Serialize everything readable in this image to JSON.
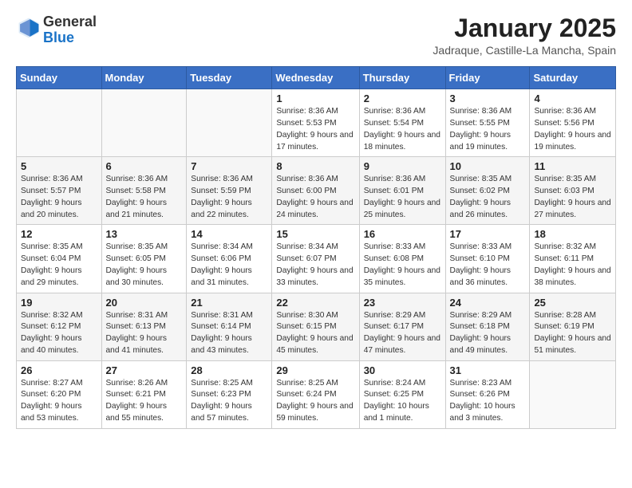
{
  "header": {
    "logo_general": "General",
    "logo_blue": "Blue",
    "month_year": "January 2025",
    "location": "Jadraque, Castille-La Mancha, Spain"
  },
  "weekdays": [
    "Sunday",
    "Monday",
    "Tuesday",
    "Wednesday",
    "Thursday",
    "Friday",
    "Saturday"
  ],
  "weeks": [
    [
      {
        "day": "",
        "info": ""
      },
      {
        "day": "",
        "info": ""
      },
      {
        "day": "",
        "info": ""
      },
      {
        "day": "1",
        "info": "Sunrise: 8:36 AM\nSunset: 5:53 PM\nDaylight: 9 hours\nand 17 minutes."
      },
      {
        "day": "2",
        "info": "Sunrise: 8:36 AM\nSunset: 5:54 PM\nDaylight: 9 hours\nand 18 minutes."
      },
      {
        "day": "3",
        "info": "Sunrise: 8:36 AM\nSunset: 5:55 PM\nDaylight: 9 hours\nand 19 minutes."
      },
      {
        "day": "4",
        "info": "Sunrise: 8:36 AM\nSunset: 5:56 PM\nDaylight: 9 hours\nand 19 minutes."
      }
    ],
    [
      {
        "day": "5",
        "info": "Sunrise: 8:36 AM\nSunset: 5:57 PM\nDaylight: 9 hours\nand 20 minutes."
      },
      {
        "day": "6",
        "info": "Sunrise: 8:36 AM\nSunset: 5:58 PM\nDaylight: 9 hours\nand 21 minutes."
      },
      {
        "day": "7",
        "info": "Sunrise: 8:36 AM\nSunset: 5:59 PM\nDaylight: 9 hours\nand 22 minutes."
      },
      {
        "day": "8",
        "info": "Sunrise: 8:36 AM\nSunset: 6:00 PM\nDaylight: 9 hours\nand 24 minutes."
      },
      {
        "day": "9",
        "info": "Sunrise: 8:36 AM\nSunset: 6:01 PM\nDaylight: 9 hours\nand 25 minutes."
      },
      {
        "day": "10",
        "info": "Sunrise: 8:35 AM\nSunset: 6:02 PM\nDaylight: 9 hours\nand 26 minutes."
      },
      {
        "day": "11",
        "info": "Sunrise: 8:35 AM\nSunset: 6:03 PM\nDaylight: 9 hours\nand 27 minutes."
      }
    ],
    [
      {
        "day": "12",
        "info": "Sunrise: 8:35 AM\nSunset: 6:04 PM\nDaylight: 9 hours\nand 29 minutes."
      },
      {
        "day": "13",
        "info": "Sunrise: 8:35 AM\nSunset: 6:05 PM\nDaylight: 9 hours\nand 30 minutes."
      },
      {
        "day": "14",
        "info": "Sunrise: 8:34 AM\nSunset: 6:06 PM\nDaylight: 9 hours\nand 31 minutes."
      },
      {
        "day": "15",
        "info": "Sunrise: 8:34 AM\nSunset: 6:07 PM\nDaylight: 9 hours\nand 33 minutes."
      },
      {
        "day": "16",
        "info": "Sunrise: 8:33 AM\nSunset: 6:08 PM\nDaylight: 9 hours\nand 35 minutes."
      },
      {
        "day": "17",
        "info": "Sunrise: 8:33 AM\nSunset: 6:10 PM\nDaylight: 9 hours\nand 36 minutes."
      },
      {
        "day": "18",
        "info": "Sunrise: 8:32 AM\nSunset: 6:11 PM\nDaylight: 9 hours\nand 38 minutes."
      }
    ],
    [
      {
        "day": "19",
        "info": "Sunrise: 8:32 AM\nSunset: 6:12 PM\nDaylight: 9 hours\nand 40 minutes."
      },
      {
        "day": "20",
        "info": "Sunrise: 8:31 AM\nSunset: 6:13 PM\nDaylight: 9 hours\nand 41 minutes."
      },
      {
        "day": "21",
        "info": "Sunrise: 8:31 AM\nSunset: 6:14 PM\nDaylight: 9 hours\nand 43 minutes."
      },
      {
        "day": "22",
        "info": "Sunrise: 8:30 AM\nSunset: 6:15 PM\nDaylight: 9 hours\nand 45 minutes."
      },
      {
        "day": "23",
        "info": "Sunrise: 8:29 AM\nSunset: 6:17 PM\nDaylight: 9 hours\nand 47 minutes."
      },
      {
        "day": "24",
        "info": "Sunrise: 8:29 AM\nSunset: 6:18 PM\nDaylight: 9 hours\nand 49 minutes."
      },
      {
        "day": "25",
        "info": "Sunrise: 8:28 AM\nSunset: 6:19 PM\nDaylight: 9 hours\nand 51 minutes."
      }
    ],
    [
      {
        "day": "26",
        "info": "Sunrise: 8:27 AM\nSunset: 6:20 PM\nDaylight: 9 hours\nand 53 minutes."
      },
      {
        "day": "27",
        "info": "Sunrise: 8:26 AM\nSunset: 6:21 PM\nDaylight: 9 hours\nand 55 minutes."
      },
      {
        "day": "28",
        "info": "Sunrise: 8:25 AM\nSunset: 6:23 PM\nDaylight: 9 hours\nand 57 minutes."
      },
      {
        "day": "29",
        "info": "Sunrise: 8:25 AM\nSunset: 6:24 PM\nDaylight: 9 hours\nand 59 minutes."
      },
      {
        "day": "30",
        "info": "Sunrise: 8:24 AM\nSunset: 6:25 PM\nDaylight: 10 hours\nand 1 minute."
      },
      {
        "day": "31",
        "info": "Sunrise: 8:23 AM\nSunset: 6:26 PM\nDaylight: 10 hours\nand 3 minutes."
      },
      {
        "day": "",
        "info": ""
      }
    ]
  ]
}
